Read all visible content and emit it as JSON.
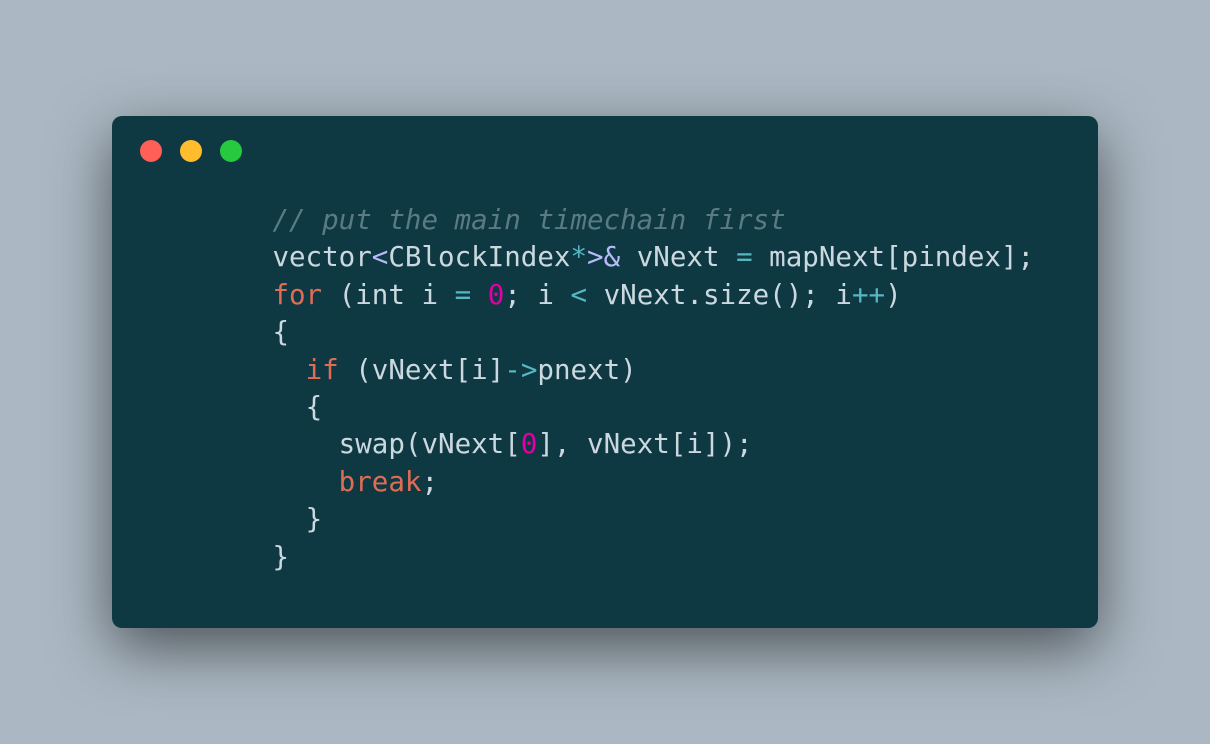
{
  "window": {
    "dots": [
      "red",
      "yellow",
      "green"
    ]
  },
  "code": {
    "lines": [
      {
        "indent": 1,
        "tokens": [
          {
            "cls": "tok-comment",
            "t": "// put the main timechain first"
          }
        ]
      },
      {
        "indent": 1,
        "tokens": [
          {
            "cls": "tok-default",
            "t": "vector"
          },
          {
            "cls": "tok-angle",
            "t": "<"
          },
          {
            "cls": "tok-default",
            "t": "CBlockIndex"
          },
          {
            "cls": "tok-star",
            "t": "*"
          },
          {
            "cls": "tok-angle",
            "t": ">"
          },
          {
            "cls": "tok-angle",
            "t": "&"
          },
          {
            "cls": "tok-default",
            "t": " vNext "
          },
          {
            "cls": "tok-op",
            "t": "="
          },
          {
            "cls": "tok-default",
            "t": " mapNext[pindex];"
          }
        ]
      },
      {
        "indent": 1,
        "tokens": [
          {
            "cls": "tok-keyword",
            "t": "for"
          },
          {
            "cls": "tok-default",
            "t": " ("
          },
          {
            "cls": "tok-type",
            "t": "int"
          },
          {
            "cls": "tok-default",
            "t": " i "
          },
          {
            "cls": "tok-op",
            "t": "="
          },
          {
            "cls": "tok-default",
            "t": " "
          },
          {
            "cls": "tok-num",
            "t": "0"
          },
          {
            "cls": "tok-default",
            "t": "; i "
          },
          {
            "cls": "tok-op",
            "t": "<"
          },
          {
            "cls": "tok-default",
            "t": " vNext.size(); i"
          },
          {
            "cls": "tok-op",
            "t": "++"
          },
          {
            "cls": "tok-default",
            "t": ")"
          }
        ]
      },
      {
        "indent": 1,
        "tokens": [
          {
            "cls": "tok-default",
            "t": "{"
          }
        ]
      },
      {
        "indent": 2,
        "tokens": [
          {
            "cls": "tok-keyword",
            "t": "if"
          },
          {
            "cls": "tok-default",
            "t": " (vNext[i]"
          },
          {
            "cls": "tok-op",
            "t": "->"
          },
          {
            "cls": "tok-default",
            "t": "pnext)"
          }
        ]
      },
      {
        "indent": 2,
        "tokens": [
          {
            "cls": "tok-default",
            "t": "{"
          }
        ]
      },
      {
        "indent": 3,
        "tokens": [
          {
            "cls": "tok-default",
            "t": "swap(vNext["
          },
          {
            "cls": "tok-num",
            "t": "0"
          },
          {
            "cls": "tok-default",
            "t": "], vNext[i]);"
          }
        ]
      },
      {
        "indent": 3,
        "tokens": [
          {
            "cls": "tok-keyword",
            "t": "break"
          },
          {
            "cls": "tok-default",
            "t": ";"
          }
        ]
      },
      {
        "indent": 2,
        "tokens": [
          {
            "cls": "tok-default",
            "t": "}"
          }
        ]
      },
      {
        "indent": 1,
        "tokens": [
          {
            "cls": "tok-default",
            "t": "}"
          }
        ]
      }
    ]
  }
}
